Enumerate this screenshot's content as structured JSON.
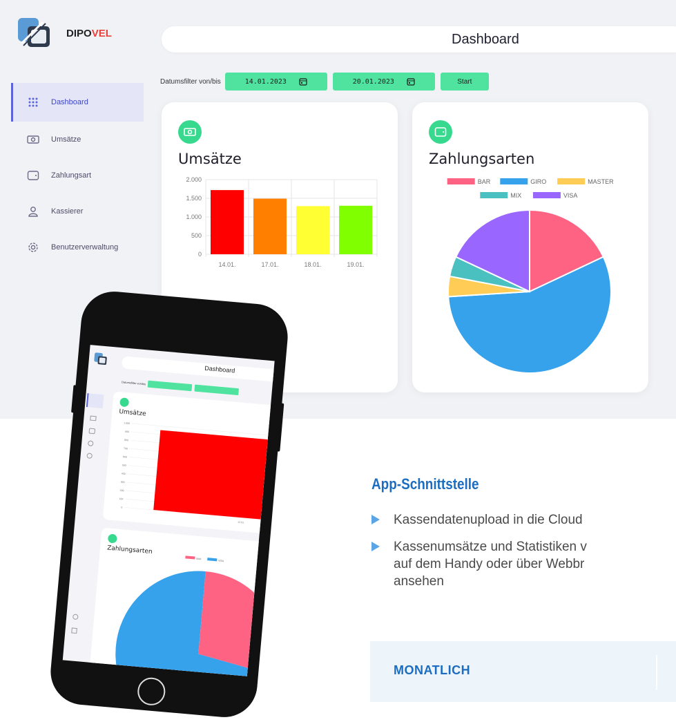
{
  "app": {
    "brand_prefix": "DIPO",
    "brand_accent": "VEL",
    "page_title": "Dashboard"
  },
  "sidebar": {
    "items": [
      {
        "label": "Dashboard",
        "icon": "grid-icon"
      },
      {
        "label": "Umsätze",
        "icon": "banknote-icon"
      },
      {
        "label": "Zahlungsart",
        "icon": "wallet-icon"
      },
      {
        "label": "Kassierer",
        "icon": "user-icon"
      },
      {
        "label": "Benutzerverwaltung",
        "icon": "gear-icon"
      }
    ]
  },
  "filter": {
    "label": "Datumsfilter von/bis",
    "from": "14.01.2023",
    "to": "20.01.2023",
    "start_label": "Start"
  },
  "colors": {
    "accent_green": "#4fe39f",
    "brand_blue": "#1c6dbf",
    "active_nav": "#5a63d8"
  },
  "chart_data": [
    {
      "type": "bar",
      "title": "Umsätze",
      "categories": [
        "14.01.",
        "17.01.",
        "18.01.",
        "19.01."
      ],
      "values": [
        1720,
        1490,
        1290,
        1300
      ],
      "colors": [
        "#ff0000",
        "#ff7f00",
        "#ffff33",
        "#7fff00"
      ],
      "y_ticks": [
        "0",
        "500",
        "1.000",
        "1.500",
        "2.000"
      ],
      "ylim": [
        0,
        2000
      ],
      "grid": true
    },
    {
      "type": "pie",
      "title": "Zahlungsarten",
      "legend": "top",
      "labels": [
        "BAR",
        "GIRO",
        "MASTER",
        "MIX",
        "VISA"
      ],
      "values": [
        18,
        56,
        4,
        4,
        18
      ],
      "colors": [
        "#ff6384",
        "#36a2eb",
        "#ffcd56",
        "#4bc0c0",
        "#9966ff"
      ]
    }
  ],
  "phone": {
    "page_title": "Dashboard",
    "filter_label": "Datumsfilter von/bis",
    "card1_title": "Umsätze",
    "card2_title": "Zahlungsarten",
    "y_ticks": [
      "0",
      "100",
      "200",
      "300",
      "400",
      "500",
      "600",
      "700",
      "800",
      "900",
      "1.000"
    ],
    "category": "12.01.",
    "legend": [
      "BAR",
      "VISA"
    ]
  },
  "promo": {
    "headline": "App-Schnittstelle",
    "bullets": [
      {
        "lines": [
          "Kassendatenupload in die Cloud"
        ]
      },
      {
        "lines": [
          "Kassenumsätze und Statistiken v",
          "auf dem Handy oder über Webbr",
          "ansehen"
        ]
      }
    ],
    "plan_label": "MONATLICH"
  }
}
